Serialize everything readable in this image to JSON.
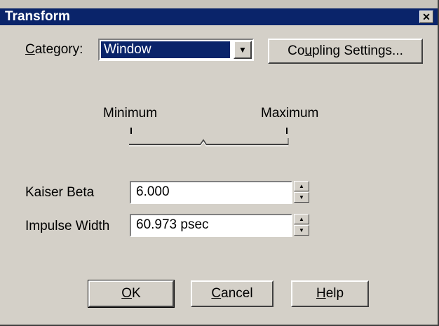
{
  "window": {
    "title": "Transform",
    "close_glyph": "✕"
  },
  "category": {
    "label_first": "C",
    "label_rest": "ategory:",
    "selected": "Window",
    "arrow_glyph": "▼"
  },
  "coupling": {
    "label_pre": "Co",
    "label_ul": "u",
    "label_post": "pling Settings..."
  },
  "slider": {
    "min_label": "Minimum",
    "max_label": "Maximum"
  },
  "kaiser_beta": {
    "label": "Kaiser Beta",
    "value": "6.000"
  },
  "impulse_width": {
    "label": "Impulse Width",
    "value": "60.973 psec"
  },
  "spin": {
    "up_glyph": "▲",
    "down_glyph": "▼"
  },
  "buttons": {
    "ok_ul": "O",
    "ok_rest": "K",
    "cancel_ul": "C",
    "cancel_rest": "ancel",
    "help_ul": "H",
    "help_rest": "elp"
  }
}
